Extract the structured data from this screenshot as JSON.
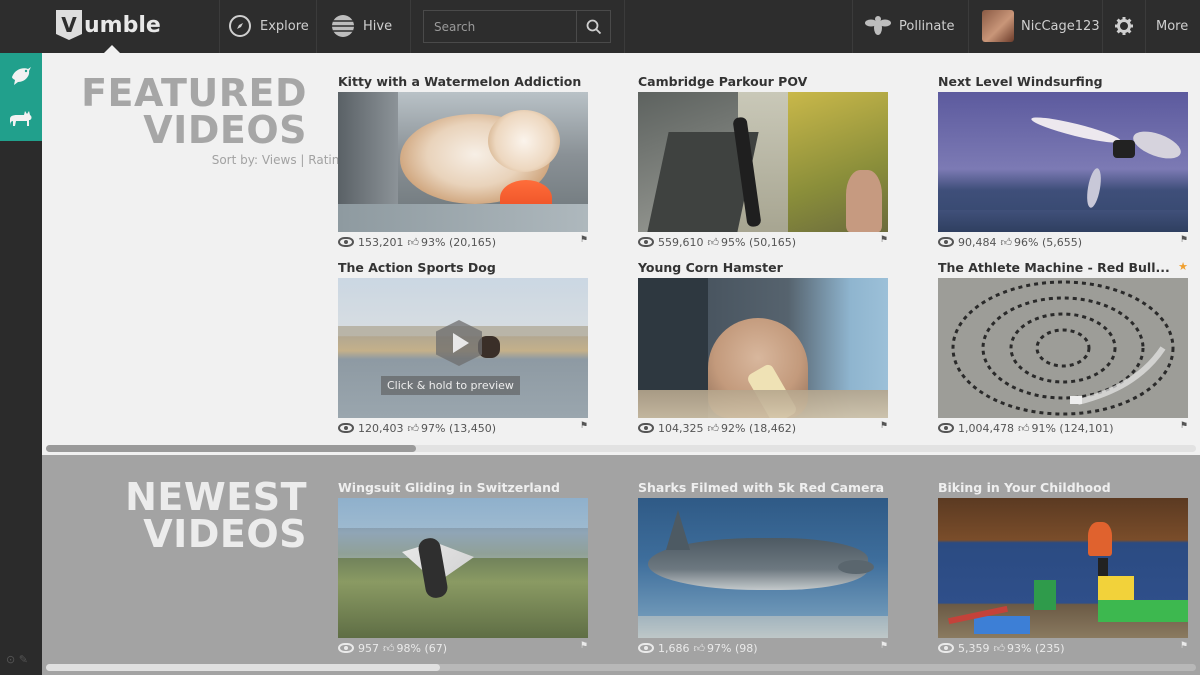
{
  "brand": {
    "logo_letter": "V",
    "logo_text": "umble"
  },
  "topnav": {
    "explore": "Explore",
    "hive": "Hive",
    "search_placeholder": "Search",
    "pollinate": "Pollinate",
    "username": "NicCage123",
    "more": "More"
  },
  "featured": {
    "title_line1": "FEATURED",
    "title_line2": "VIDEOS",
    "sort_label": "Sort by:",
    "sort_views": "Views",
    "sort_divider": "|",
    "sort_rating": "Rating",
    "videos": [
      {
        "title": "Kitty with a Watermelon Addiction",
        "views": "153,201",
        "rating": "93% (20,165)"
      },
      {
        "title": "Cambridge Parkour POV",
        "views": "559,610",
        "rating": "95% (50,165)"
      },
      {
        "title": "Next Level Windsurfing",
        "views": "90,484",
        "rating": "96% (5,655)"
      },
      {
        "title": "The Action Sports Dog",
        "views": "120,403",
        "rating": "97% (13,450)",
        "overlay": "Click & hold to preview"
      },
      {
        "title": "Young Corn Hamster",
        "views": "104,325",
        "rating": "92% (18,462)"
      },
      {
        "title": "The Athlete Machine - Red Bull...",
        "views": "1,004,478",
        "rating": "91% (124,101)",
        "starred": "★"
      }
    ]
  },
  "newest": {
    "title_line1": "NEWEST",
    "title_line2": "VIDEOS",
    "videos": [
      {
        "title": "Wingsuit Gliding in Switzerland",
        "views": "957",
        "rating": "98% (67)"
      },
      {
        "title": "Sharks Filmed with 5k Red Camera",
        "views": "1,686",
        "rating": "97% (98)"
      },
      {
        "title": "Biking in Your Childhood",
        "views": "5,359",
        "rating": "93% (235)"
      }
    ]
  },
  "colors": {
    "accent": "#21a08c",
    "topbar": "#2d2d2d",
    "featured_bg": "#f1f1f1",
    "newest_bg": "#a3a3a3",
    "star": "#f0a030"
  }
}
